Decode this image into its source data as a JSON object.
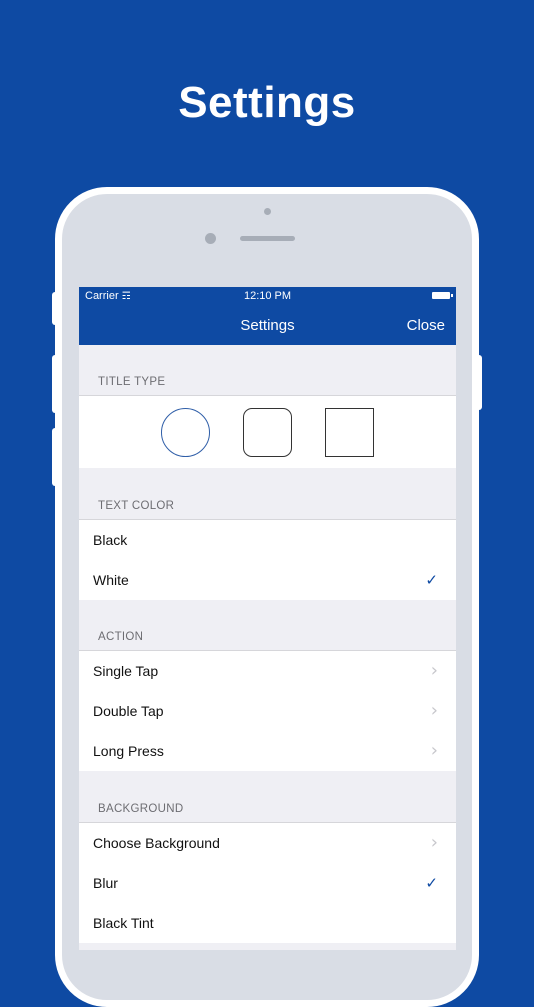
{
  "promo": {
    "title": "Settings"
  },
  "status_bar": {
    "carrier": "Carrier",
    "time": "12:10 PM"
  },
  "navbar": {
    "title": "Settings",
    "close_label": "Close"
  },
  "sections": {
    "title_type": {
      "header": "TITLE TYPE",
      "options": [
        "circle",
        "rounded-square",
        "square"
      ],
      "selected": "circle"
    },
    "text_color": {
      "header": "TEXT COLOR",
      "items": [
        {
          "label": "Black",
          "checked": false
        },
        {
          "label": "White",
          "checked": true
        }
      ]
    },
    "action": {
      "header": "ACTION",
      "items": [
        {
          "label": "Single Tap"
        },
        {
          "label": "Double Tap"
        },
        {
          "label": "Long Press"
        }
      ]
    },
    "background": {
      "header": "BACKGROUND",
      "items": [
        {
          "label": "Choose Background",
          "accessory": "chevron"
        },
        {
          "label": "Blur",
          "accessory": "checkmark"
        },
        {
          "label": "Black Tint",
          "accessory": "none"
        }
      ]
    }
  },
  "colors": {
    "brand": "#0e4aa3",
    "accent": "#2f5ea8",
    "background": "#efeff4"
  }
}
